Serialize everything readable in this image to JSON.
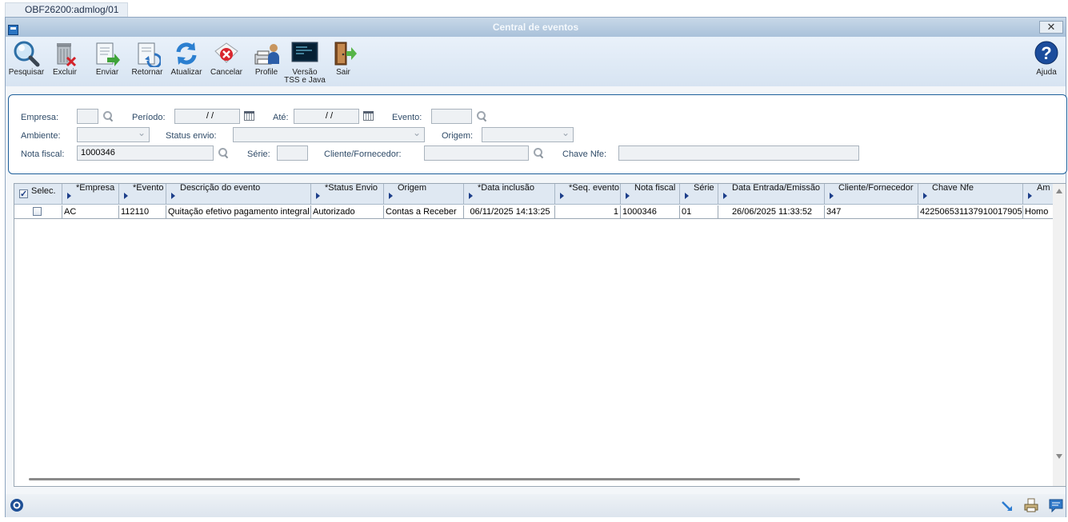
{
  "tab": {
    "label": "OBF26200:admlog/01"
  },
  "window": {
    "title": "Central de eventos",
    "close": "✕"
  },
  "toolbar": {
    "pesquisar": "Pesquisar",
    "excluir": "Excluir",
    "enviar": "Enviar",
    "retornar": "Retornar",
    "atualizar": "Atualizar",
    "cancelar": "Cancelar",
    "profile": "Profile",
    "versao": "Versão\nTSS e Java",
    "sair": "Sair",
    "ajuda": "Ajuda"
  },
  "filters": {
    "empresa": {
      "label": "Empresa:",
      "value": ""
    },
    "periodo": {
      "label": "Período:",
      "value": " / /"
    },
    "ate": {
      "label": "Até:",
      "value": " / /"
    },
    "evento": {
      "label": "Evento:",
      "value": ""
    },
    "ambiente": {
      "label": "Ambiente:",
      "value": ""
    },
    "status_envio": {
      "label": "Status envio:",
      "value": ""
    },
    "origem": {
      "label": "Origem:",
      "value": ""
    },
    "nota_fiscal": {
      "label": "Nota fiscal:",
      "value": "1000346"
    },
    "serie": {
      "label": "Série:",
      "value": ""
    },
    "cliente_fornecedor": {
      "label": "Cliente/Fornecedor:",
      "value": ""
    },
    "chave_nfe": {
      "label": "Chave Nfe:",
      "value": ""
    }
  },
  "grid": {
    "headers": {
      "selec": "Selec.",
      "empresa": "*Empresa",
      "evento": "*Evento",
      "descricao": "Descrição do evento",
      "status": "*Status Envio",
      "origem": "Origem",
      "data_inclusao": "*Data inclusão",
      "seq_evento": "*Seq. evento",
      "nota_fiscal": "Nota fiscal",
      "serie": "Série",
      "data_entrada": "Data Entrada/Emissão",
      "cliente": "Cliente/Fornecedor",
      "chave": "Chave Nfe",
      "ambiente": "Am"
    },
    "rows": [
      {
        "empresa": "AC",
        "evento": "112110",
        "descricao": "Quitação efetivo pagamento integral",
        "status": "Autorizado",
        "origem": "Contas a Receber",
        "data_inclusao": "06/11/2025 14:13:25",
        "seq_evento": "1",
        "nota_fiscal": "1000346",
        "serie": "01",
        "data_entrada": "26/06/2025 11:33:52",
        "cliente": "347",
        "chave": "422506531137910017905",
        "ambiente": "Homo"
      }
    ]
  }
}
